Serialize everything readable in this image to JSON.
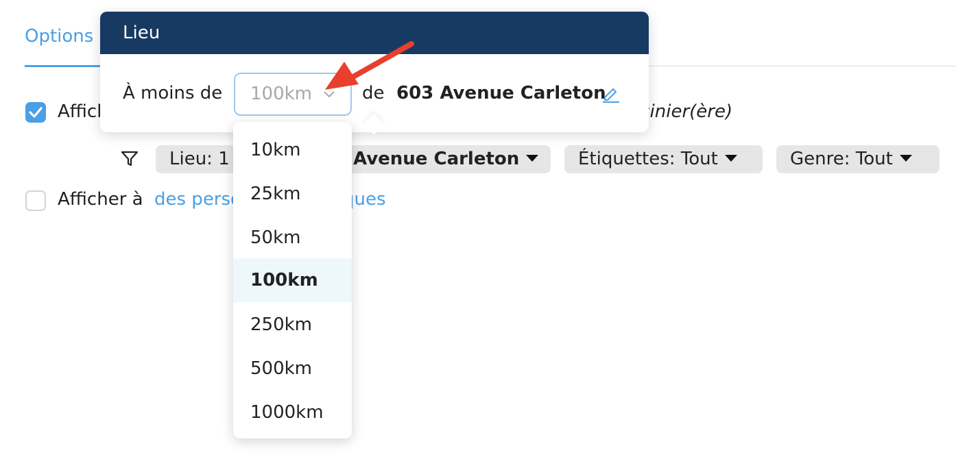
{
  "tab": {
    "label": "Options"
  },
  "row1": {
    "label_partial": "Affich",
    "italic_tail": "sinier(ère)"
  },
  "filters": {
    "location_chip_prefix": "Lieu:  1",
    "location_chip_tail": "Avenue Carleton",
    "tags_chip": "Étiquettes:  Tout",
    "gender_chip": "Genre:  Tout"
  },
  "row2": {
    "label": "Afficher à",
    "link_start": "des perso",
    "link_end": "ques"
  },
  "popover": {
    "title": "Lieu",
    "within_label": "À moins de",
    "selected_distance": "100km",
    "of_label": "de",
    "address": "603 Avenue Carleton"
  },
  "distance_options": [
    {
      "label": "10km",
      "selected": false
    },
    {
      "label": "25km",
      "selected": false
    },
    {
      "label": "50km",
      "selected": false
    },
    {
      "label": "100km",
      "selected": true
    },
    {
      "label": "250km",
      "selected": false
    },
    {
      "label": "500km",
      "selected": false
    },
    {
      "label": "1000km",
      "selected": false
    }
  ],
  "colors": {
    "accent": "#4a9fe6",
    "header_bg": "#173a63",
    "annotation_arrow": "#e8402c",
    "selected_option_bg": "#eef7fc"
  },
  "icons": {
    "filter": "filter-icon",
    "chevron": "chevron-down-icon",
    "edit": "pencil-icon",
    "check": "checkmark-icon"
  }
}
